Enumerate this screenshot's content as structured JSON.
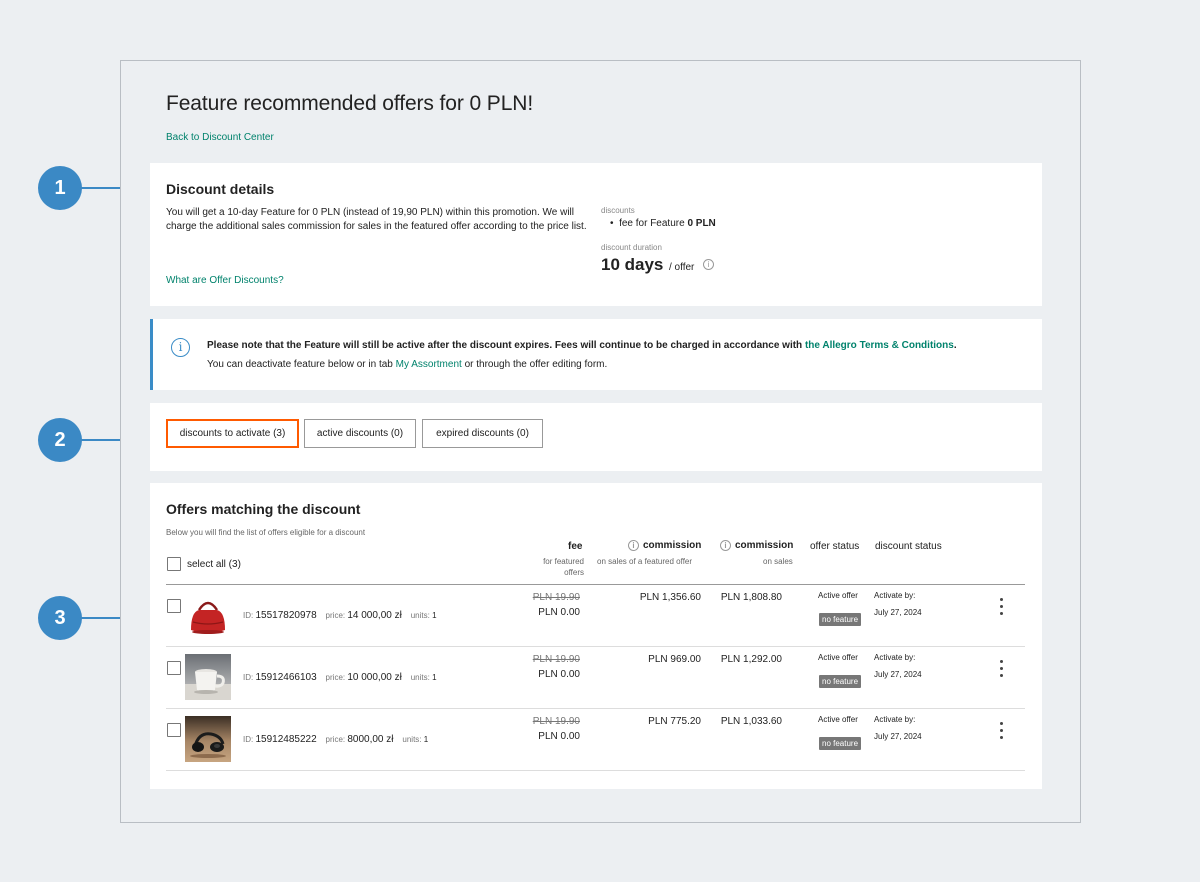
{
  "page": {
    "title": "Feature recommended offers for 0 PLN!",
    "back_link": "Back to Discount Center"
  },
  "details": {
    "heading": "Discount details",
    "text": "You will get a 10-day Feature for 0 PLN (instead of 19,90 PLN) within this promotion. We will charge the additional sales commission for sales in the featured offer according to the price list.",
    "link": "What are Offer Discounts?",
    "discounts_label": "discounts",
    "discount_item_prefix": "fee for Feature",
    "discount_item_value": "0 PLN",
    "duration_label": "discount duration",
    "duration_value": "10 days",
    "duration_unit": "/ offer"
  },
  "note": {
    "line1_text": "Please note that the Feature will still be active after the discount expires. Fees will continue to be charged in accordance with ",
    "line1_link": "the Allegro Terms & Conditions",
    "line1_end": ".",
    "line2_start": "You can deactivate feature below or in tab ",
    "line2_link": "My Assortment",
    "line2_end": " or through the offer editing form."
  },
  "tabs": [
    {
      "label": "discounts to activate (3)",
      "active": true
    },
    {
      "label": "active discounts (0)",
      "active": false
    },
    {
      "label": "expired discounts (0)",
      "active": false
    }
  ],
  "offers": {
    "heading": "Offers matching the discount",
    "subheading": "Below you will find the list of offers eligible for a discount",
    "select_all": "select all (3)",
    "columns": {
      "fee": "fee",
      "fee_sub1": "for featured",
      "fee_sub2": "offers",
      "comm1": "commission",
      "comm1_sub": "on sales of a featured offer",
      "comm2": "commission",
      "comm2_sub": "on sales",
      "offer_status": "offer status",
      "discount_status": "discount status"
    },
    "labels": {
      "id": "ID:",
      "price": "price:",
      "units": "units:"
    },
    "rows": [
      {
        "id": "15517820978",
        "price": "14 000,00 zł",
        "units": "1",
        "fee_old": "PLN 19.90",
        "fee_new": "PLN 0.00",
        "comm1": "PLN 1,356.60",
        "comm2": "PLN 1,808.80",
        "offer_status": "Active offer",
        "badge": "no feature",
        "activate_by": "Activate by:",
        "date": "July 27, 2024"
      },
      {
        "id": "15912466103",
        "price": "10 000,00 zł",
        "units": "1",
        "fee_old": "PLN 19.90",
        "fee_new": "PLN 0.00",
        "comm1": "PLN 969.00",
        "comm2": "PLN 1,292.00",
        "offer_status": "Active offer",
        "badge": "no feature",
        "activate_by": "Activate by:",
        "date": "July 27, 2024"
      },
      {
        "id": "15912485222",
        "price": "8000,00 zł",
        "units": "1",
        "fee_old": "PLN 19.90",
        "fee_new": "PLN 0.00",
        "comm1": "PLN 775.20",
        "comm2": "PLN 1,033.60",
        "offer_status": "Active offer",
        "badge": "no feature",
        "activate_by": "Activate by:",
        "date": "July 27, 2024"
      }
    ]
  },
  "markers": [
    "1",
    "2",
    "3"
  ],
  "colors": {
    "accent_green": "#00826c",
    "tab_active": "#ff5a00",
    "marker_blue": "#3b89c5",
    "info_blue": "#3a8cc7"
  },
  "icons": [
    "info-icon",
    "handbag-thumbnail",
    "mug-thumbnail",
    "headphones-thumbnail",
    "kebab-menu-icon"
  ]
}
